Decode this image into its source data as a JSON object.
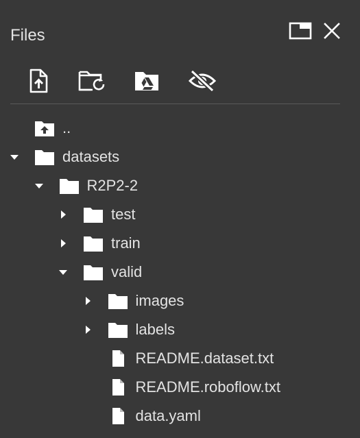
{
  "panel": {
    "title": "Files"
  },
  "header": {
    "icons": [
      "maximize-icon",
      "close-icon"
    ]
  },
  "toolbar": {
    "icons": [
      "upload-file-icon",
      "refresh-folder-icon",
      "mount-drive-icon",
      "hide-files-icon"
    ]
  },
  "tree": {
    "items": [
      {
        "label": "..",
        "icon": "parent-folder-icon",
        "depth": 0,
        "caret": "none"
      },
      {
        "label": "datasets",
        "icon": "folder-icon",
        "depth": 0,
        "caret": "expanded"
      },
      {
        "label": "R2P2-2",
        "icon": "folder-icon",
        "depth": 1,
        "caret": "expanded"
      },
      {
        "label": "test",
        "icon": "folder-icon",
        "depth": 2,
        "caret": "collapsed"
      },
      {
        "label": "train",
        "icon": "folder-icon",
        "depth": 2,
        "caret": "collapsed"
      },
      {
        "label": "valid",
        "icon": "folder-icon",
        "depth": 2,
        "caret": "expanded"
      },
      {
        "label": "images",
        "icon": "folder-icon",
        "depth": 3,
        "caret": "collapsed"
      },
      {
        "label": "labels",
        "icon": "folder-icon",
        "depth": 3,
        "caret": "collapsed"
      },
      {
        "label": "README.dataset.txt",
        "icon": "file-icon",
        "depth": 3,
        "caret": "none"
      },
      {
        "label": "README.roboflow.txt",
        "icon": "file-icon",
        "depth": 3,
        "caret": "none"
      },
      {
        "label": "data.yaml",
        "icon": "file-icon",
        "depth": 3,
        "caret": "none"
      }
    ]
  },
  "colors": {
    "background": "#383838",
    "text": "#e3e3e3",
    "icon": "#ffffff",
    "divider": "#5a5a5a"
  }
}
